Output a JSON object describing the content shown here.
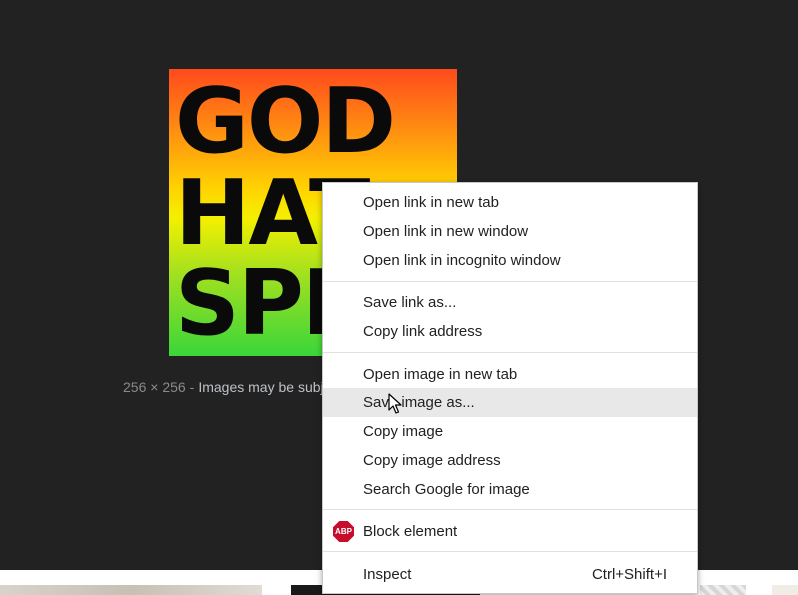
{
  "image_preview": {
    "line1": "GOD",
    "line2": "HAT",
    "line3": "SPI",
    "dimensions": "256 × 256",
    "separator": "-",
    "notice": "Images may be subje"
  },
  "context_menu": {
    "open_link_new_tab": "Open link in new tab",
    "open_link_new_window": "Open link in new window",
    "open_link_incognito": "Open link in incognito window",
    "save_link_as": "Save link as...",
    "copy_link_address": "Copy link address",
    "open_image_new_tab": "Open image in new tab",
    "save_image_as": "Save image as...",
    "copy_image": "Copy image",
    "copy_image_address": "Copy image address",
    "search_google_image": "Search Google for image",
    "block_element": "Block element",
    "abp_badge": "ABP",
    "inspect": "Inspect",
    "inspect_shortcut": "Ctrl+Shift+I",
    "highlighted_item": "Save image as...",
    "icons": {
      "block_element": "adblock-plus-icon",
      "cursor": "mouse-pointer-icon"
    }
  },
  "colors": {
    "background": "#222222",
    "menu_bg": "#ffffff",
    "menu_highlight": "#e8e8e9",
    "abp_red": "#c70d2c"
  }
}
